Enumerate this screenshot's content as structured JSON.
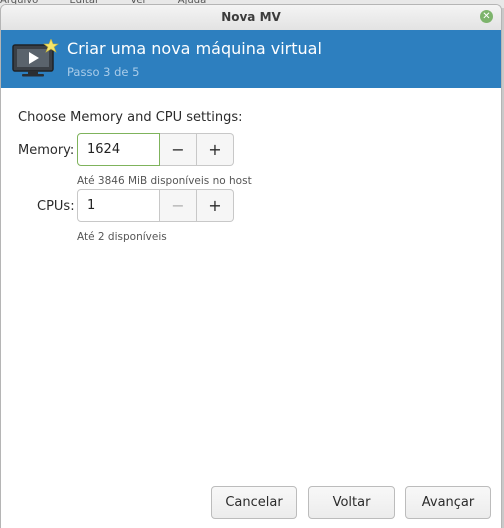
{
  "background_menu": [
    "Arquivo",
    "Editar",
    "Ver",
    "Ajuda"
  ],
  "window": {
    "title": "Nova MV",
    "close_icon": "close-icon"
  },
  "banner": {
    "title": "Criar uma nova máquina virtual",
    "step": "Passo 3 de 5",
    "icon": "new-vm-icon",
    "color": "#2d7fbf"
  },
  "settings": {
    "section_title": "Choose Memory and CPU settings:",
    "memory": {
      "label": "Memory:",
      "value": "1624",
      "hint": "Até 3846 MiB disponíveis no host",
      "decrement": "−",
      "increment": "+"
    },
    "cpus": {
      "label": "CPUs:",
      "value": "1",
      "hint": "Até 2 disponíveis",
      "decrement": "−",
      "increment": "+"
    }
  },
  "footer": {
    "cancel": "Cancelar",
    "back": "Voltar",
    "forward": "Avançar"
  }
}
